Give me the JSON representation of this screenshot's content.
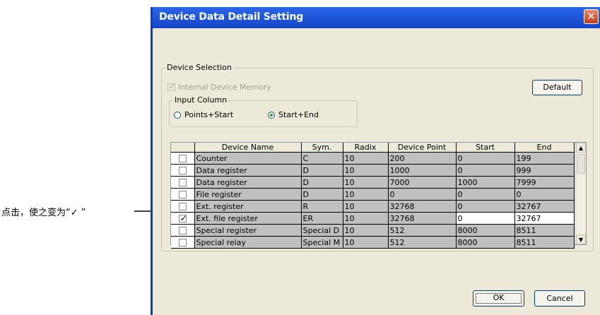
{
  "annotation": {
    "text": "点击，使之变为“✓ ”"
  },
  "window": {
    "title": "Device Data Detail Setting",
    "close_label": "✕"
  },
  "device_selection": {
    "label": "Device Selection",
    "internal_memory_label": "Internal Device Memory",
    "internal_memory_checked": true,
    "default_label": "Default"
  },
  "input_column": {
    "label": "Input Column",
    "options": [
      "Points+Start",
      "Start+End"
    ],
    "selected": "Start+End"
  },
  "table": {
    "columns": [
      "Device Name",
      "Sym.",
      "Radix",
      "Device Point",
      "Start",
      "End"
    ],
    "rows": [
      {
        "checked": false,
        "cells": [
          "Counter",
          "C",
          "10",
          "200",
          "0",
          "199"
        ]
      },
      {
        "checked": false,
        "cells": [
          "Data register",
          "D",
          "10",
          "1000",
          "0",
          "999"
        ]
      },
      {
        "checked": false,
        "cells": [
          "Data register",
          "D",
          "10",
          "7000",
          "1000",
          "7999"
        ]
      },
      {
        "checked": false,
        "cells": [
          "File register",
          "D",
          "10",
          "0",
          "0",
          "0"
        ]
      },
      {
        "checked": false,
        "cells": [
          "Ext. register",
          "R",
          "10",
          "32768",
          "0",
          "32767"
        ]
      },
      {
        "checked": true,
        "cells": [
          "Ext. file register",
          "ER",
          "10",
          "32768",
          "0",
          "32767"
        ]
      },
      {
        "checked": false,
        "cells": [
          "Special register",
          "Special D",
          "10",
          "512",
          "8000",
          "8511"
        ]
      },
      {
        "checked": false,
        "cells": [
          "Special relay",
          "Special M",
          "10",
          "512",
          "8000",
          "8511"
        ]
      }
    ]
  },
  "buttons": {
    "ok": "OK",
    "cancel": "Cancel"
  }
}
